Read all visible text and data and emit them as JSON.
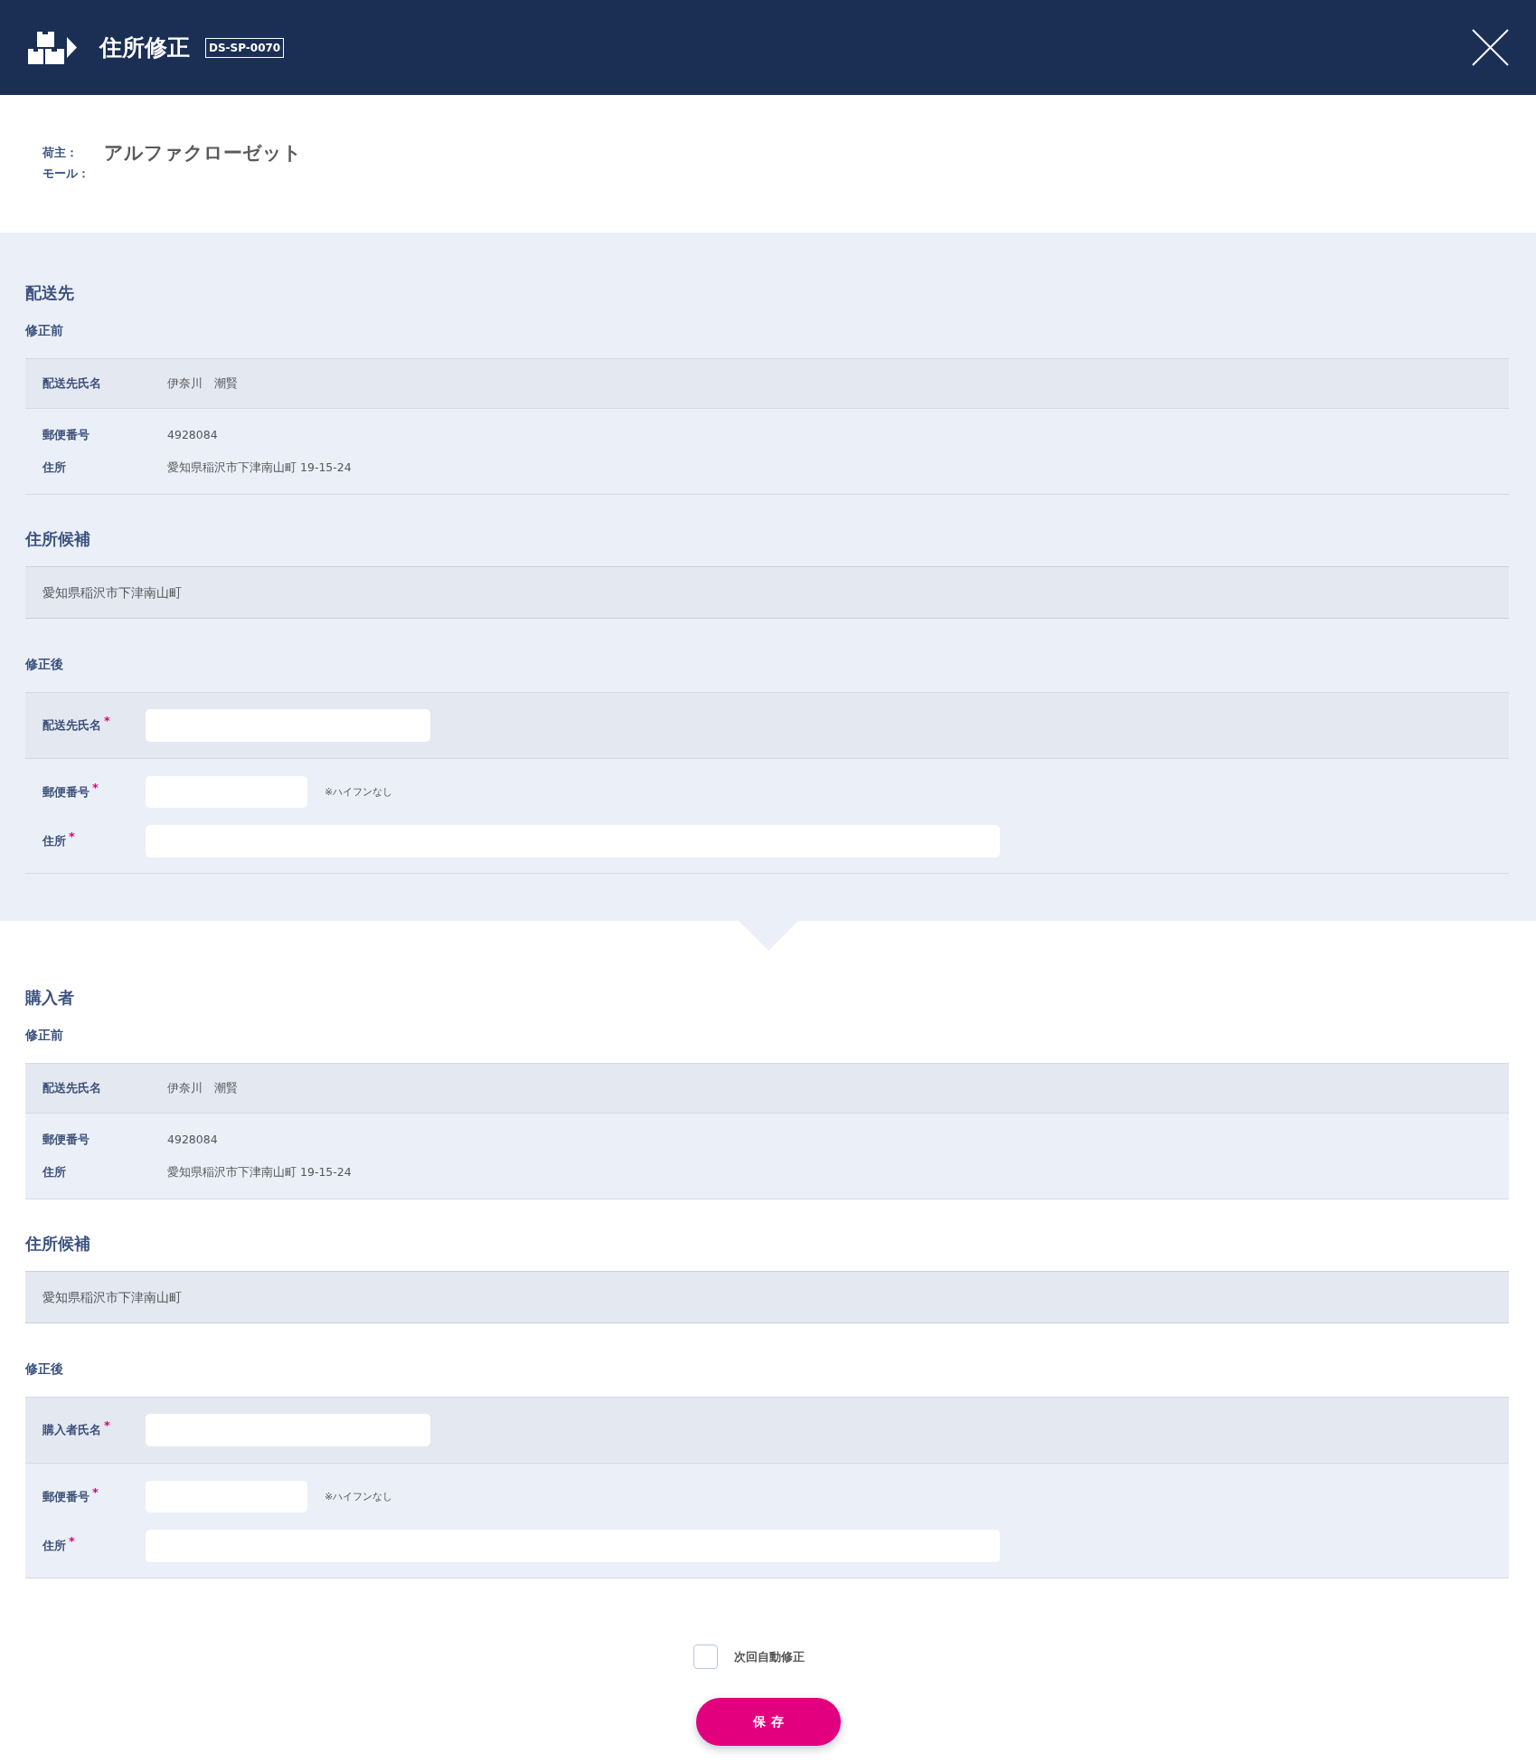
{
  "header": {
    "title": "住所修正",
    "screen_id": "DS-SP-0070"
  },
  "info": [
    {
      "label": "荷主：",
      "value": "アルファクローゼット"
    },
    {
      "label": "モール："
    }
  ],
  "sections": [
    {
      "title": "配送先",
      "shaded": true,
      "before": {
        "title": "修正前",
        "groups": [
          {
            "rows": [
              {
                "label": "配送先氏名",
                "value": "伊奈川　潮賢"
              }
            ]
          },
          {
            "rows": [
              {
                "label": "郵便番号",
                "value": "4928084"
              },
              {
                "label": "住所",
                "value": "愛知県稲沢市下津南山町 19-15-24"
              }
            ]
          }
        ]
      },
      "candidates": {
        "title": "住所候補",
        "items": [
          "愛知県稲沢市下津南山町"
        ]
      },
      "after": {
        "title": "修正後",
        "groups": [
          {
            "fields": [
              {
                "kind": "name",
                "label": "配送先氏名",
                "required_mark": "*"
              }
            ]
          },
          {
            "fields": [
              {
                "kind": "postal",
                "label": "郵便番号",
                "required_mark": "*",
                "note": "※ハイフンなし"
              },
              {
                "kind": "address",
                "label": "住所",
                "required_mark": "*"
              }
            ]
          }
        ]
      }
    },
    {
      "title": "購入者",
      "shaded": false,
      "before": {
        "title": "修正前",
        "groups": [
          {
            "rows": [
              {
                "label": "配送先氏名",
                "value": "伊奈川　潮賢"
              }
            ]
          },
          {
            "rows": [
              {
                "label": "郵便番号",
                "value": "4928084"
              },
              {
                "label": "住所",
                "value": "愛知県稲沢市下津南山町 19-15-24"
              }
            ]
          }
        ]
      },
      "candidates": {
        "title": "住所候補",
        "items": [
          "愛知県稲沢市下津南山町"
        ]
      },
      "after": {
        "title": "修正後",
        "groups": [
          {
            "fields": [
              {
                "kind": "name",
                "label": "購入者氏名",
                "required_mark": "*"
              }
            ]
          },
          {
            "fields": [
              {
                "kind": "postal",
                "label": "郵便番号",
                "required_mark": "*",
                "note": "※ハイフンなし"
              },
              {
                "kind": "address",
                "label": "住所",
                "required_mark": "*"
              }
            ]
          }
        ]
      }
    }
  ],
  "auto_fix": {
    "label": "次回自動修正",
    "checked": false
  },
  "save_button": {
    "label": "保存"
  }
}
